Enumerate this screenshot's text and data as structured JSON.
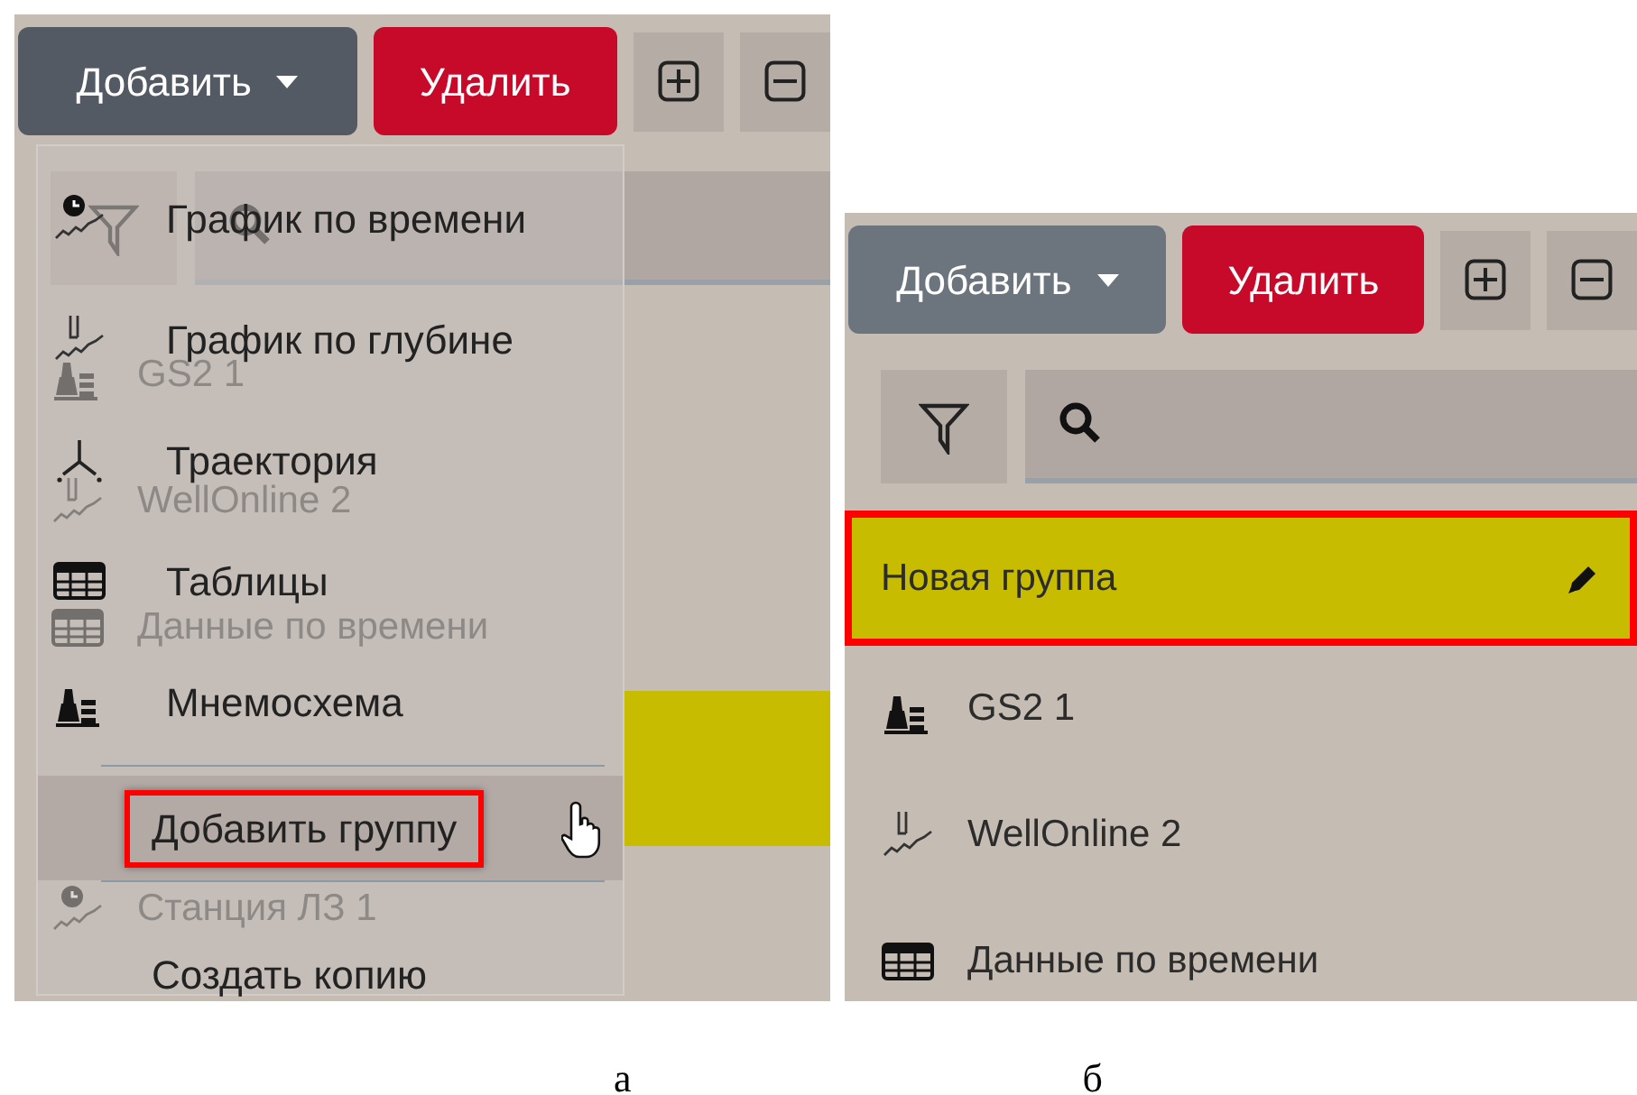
{
  "panels": [
    {
      "caption": "а",
      "toolbar": {
        "add_button": "Добавить",
        "delete_button": "Удалить"
      },
      "list_items": [
        {
          "kind": "mnemonic",
          "label": "GS2 1",
          "selected": false
        },
        {
          "kind": "depth_chart",
          "label": "WellOnline 2",
          "selected": false
        },
        {
          "kind": "table",
          "label": "Данные по времени",
          "selected": false
        },
        {
          "kind": "group",
          "selected": true
        },
        {
          "kind": "time_chart",
          "label": "Станция ЛЗ 1",
          "selected": false
        }
      ],
      "menu": {
        "items": [
          {
            "kind": "time_chart",
            "label": "График по времени",
            "hovered": false,
            "outlined": false
          },
          {
            "kind": "depth_chart",
            "label": "График по глубине",
            "hovered": false,
            "outlined": false
          },
          {
            "kind": "trajectory",
            "label": "Траектория",
            "hovered": false,
            "outlined": false
          },
          {
            "kind": "table",
            "label": "Таблицы",
            "hovered": false,
            "outlined": false
          },
          {
            "kind": "mnemonic",
            "label": "Мнемосхема",
            "hovered": false,
            "outlined": false
          },
          {
            "kind": "divider"
          },
          {
            "kind": "plain",
            "label": "Добавить группу",
            "hovered": true,
            "outlined": true
          },
          {
            "kind": "divider"
          },
          {
            "kind": "plain",
            "label": "Создать копию",
            "hovered": false,
            "outlined": false
          }
        ]
      }
    },
    {
      "caption": "б",
      "toolbar": {
        "add_button": "Добавить",
        "delete_button": "Удалить"
      },
      "list_items": [
        {
          "kind": "group",
          "label": "Новая группа",
          "selected": true,
          "outlined": true
        },
        {
          "kind": "mnemonic",
          "label": "GS2 1",
          "selected": false,
          "outlined": false
        },
        {
          "kind": "depth_chart",
          "label": "WellOnline 2",
          "selected": false,
          "outlined": false
        },
        {
          "kind": "table",
          "label": "Данные по времени",
          "selected": false,
          "outlined": false
        }
      ]
    }
  ]
}
